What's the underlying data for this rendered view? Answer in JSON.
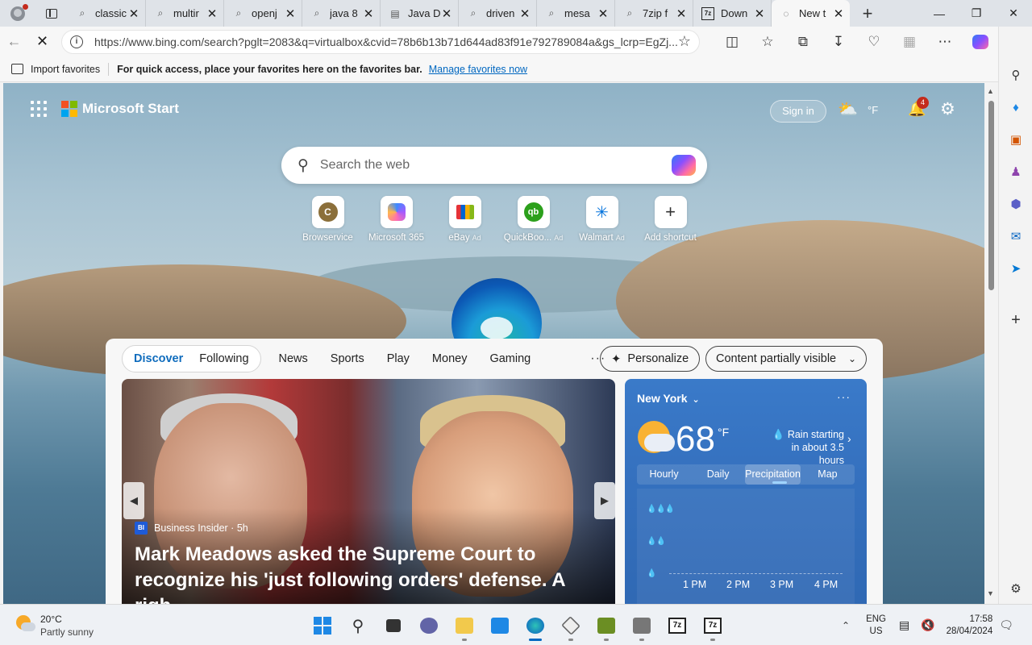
{
  "browser": {
    "tabs": [
      {
        "title": "classic",
        "icon": "search-icon"
      },
      {
        "title": "multir",
        "icon": "search-icon"
      },
      {
        "title": "openj",
        "icon": "search-icon"
      },
      {
        "title": "java 8",
        "icon": "search-icon"
      },
      {
        "title": "Java D",
        "icon": "document-icon"
      },
      {
        "title": "driven",
        "icon": "search-icon"
      },
      {
        "title": "mesa",
        "icon": "search-icon"
      },
      {
        "title": "7zip f",
        "icon": "search-icon"
      },
      {
        "title": "Down",
        "icon": "7zip-icon"
      },
      {
        "title": "New t",
        "icon": "loading-icon",
        "active": true
      }
    ],
    "address": "https://www.bing.com/search?pglt=2083&q=virtualbox&cvid=78b6b13b71d644ad83f91e792789084a&gs_lcrp=EgZj...",
    "favorites_bar": {
      "import_label": "Import favorites",
      "message": "For quick access, place your favorites here on the favorites bar.",
      "manage_link": "Manage favorites now"
    }
  },
  "start_page": {
    "brand": "Microsoft Start",
    "sign_in": "Sign in",
    "header_temp": "°F",
    "notification_count": "4",
    "search_placeholder": "Search the web",
    "shortcuts": [
      {
        "label": "Browservice",
        "ad": ""
      },
      {
        "label": "Microsoft 365",
        "ad": ""
      },
      {
        "label": "eBay",
        "ad": "Ad"
      },
      {
        "label": "QuickBoo...",
        "ad": "Ad"
      },
      {
        "label": "Walmart",
        "ad": "Ad"
      },
      {
        "label": "Add shortcut",
        "ad": ""
      }
    ],
    "feed": {
      "pill_tabs": [
        "Discover",
        "Following"
      ],
      "tabs": [
        "News",
        "Sports",
        "Play",
        "Money",
        "Gaming"
      ],
      "more": "···",
      "personalize": "Personalize",
      "content_visibility": "Content partially visible"
    },
    "hero": {
      "source_badge": "BI",
      "source": "Business Insider · 5h",
      "headline": "Mark Meadows asked the Supreme Court to recognize his 'just following orders' defense. A righ..."
    },
    "weather": {
      "city": "New York",
      "temp": "68",
      "unit": "°F",
      "rain": "Rain starting in about 3.5 hours",
      "tabs": [
        "Hourly",
        "Daily",
        "Precipitation",
        "Map"
      ],
      "selected_tab": "Precipitation",
      "times": [
        "1 PM",
        "2 PM",
        "3 PM",
        "4 PM"
      ]
    }
  },
  "taskbar": {
    "weather_temp": "20°C",
    "weather_condition": "Partly sunny",
    "language_line1": "ENG",
    "language_line2": "US",
    "time": "17:58",
    "date": "28/04/2024"
  },
  "colors": {
    "accent": "#0f6cbd",
    "link": "#0067c0",
    "weather_card": "#3571bf",
    "badge": "#c42b1c"
  }
}
